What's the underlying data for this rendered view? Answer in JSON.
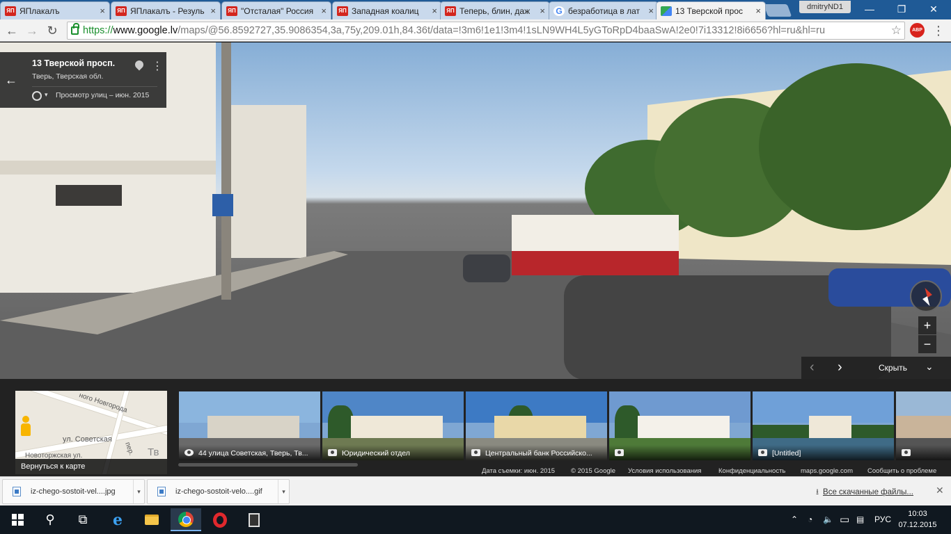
{
  "browser": {
    "tabs": [
      {
        "title": "ЯПлакалъ",
        "favicon": "yaplakal-icon"
      },
      {
        "title": "ЯПлакалъ - Резуль",
        "favicon": "yaplakal-icon"
      },
      {
        "title": "\"Отсталая\" Россия",
        "favicon": "yaplakal-icon"
      },
      {
        "title": "Западная коалиц",
        "favicon": "yaplakal-icon"
      },
      {
        "title": "Теперь, блин, даж",
        "favicon": "yaplakal-icon"
      },
      {
        "title": "безработица в лат",
        "favicon": "google-icon"
      },
      {
        "title": "13 Тверской прос",
        "favicon": "maps-icon"
      }
    ],
    "favicon_text": "ЯП",
    "close_glyph": "×",
    "user": "dmitryND1",
    "window_controls": {
      "minimize": "—",
      "maximize": "❐",
      "close": "✕"
    },
    "nav": {
      "back": "←",
      "forward": "→",
      "reload": "↻"
    },
    "url": {
      "scheme": "https://",
      "host": "www.google.lv",
      "path": "/maps/@56.8592727,35.9086354,3a,75y,209.01h,84.36t/data=!3m6!1e1!3m4!1sLN9WH4L5yGToRpD4baaSwA!2e0!7i13312!8i6656?hl=ru&hl=ru"
    },
    "star_glyph": "☆",
    "adblock_label": "ABP",
    "menu_glyph": "⋮",
    "accent_color": "#1a8f2d"
  },
  "streetview": {
    "address_title": "13 Тверской просп.",
    "address_sub": "Тверь, Тверская обл.",
    "back_glyph": "←",
    "more_glyph": "⋮",
    "caret_glyph": "▾",
    "date_label": "Просмотр улиц – июн. 2015",
    "zoom_in": "+",
    "zoom_out": "−",
    "prev_glyph": "‹",
    "next_glyph": "›",
    "hide_label": "Скрыть",
    "hide_chevron": "⌄"
  },
  "filmstrip": {
    "minimap": {
      "back_label": "Вернуться к карте",
      "labels": {
        "novgorod": "ного Новгорода",
        "sovetskaya": "ул. Советская",
        "novotorzhskaya": "Новоторжская ул.",
        "tv": "Тв",
        "per": "пер."
      }
    },
    "thumbs": [
      {
        "caption": "44 улица Советская, Тверь, Тв...",
        "icon": "street-view-icon"
      },
      {
        "caption": "Юридический отдел",
        "icon": "camera-icon"
      },
      {
        "caption": "Центральный банк Российско...",
        "icon": "camera-icon"
      },
      {
        "caption": "",
        "icon": "camera-icon"
      },
      {
        "caption": "[Untitled]",
        "icon": "camera-icon"
      },
      {
        "caption": "",
        "icon": "camera-icon"
      }
    ],
    "legal": {
      "date": "Дата съемки: июн. 2015",
      "copyright": "© 2015 Google",
      "terms": "Условия использования",
      "privacy": "Конфиденциальность",
      "site": "maps.google.com",
      "report": "Сообщить о проблеме"
    }
  },
  "downloads": {
    "items": [
      {
        "name": "iz-chego-sostoit-vel....jpg"
      },
      {
        "name": "iz-chego-sostoit-velo....gif"
      }
    ],
    "caret": "▾",
    "all_downloads": "Все скачанные файлы...",
    "download_arrow": "⭳",
    "close_glyph": "✕"
  },
  "taskbar": {
    "search_glyph": "⚲",
    "taskview_glyph": "⧉",
    "ie_glyph": "e",
    "tray_up": "⌃",
    "wifi_glyph": "◔",
    "volume_glyph": "🔈",
    "battery_glyph": "▭",
    "message_glyph": "▤",
    "language": "РУС",
    "time": "10:03",
    "date": "07.12.2015"
  }
}
